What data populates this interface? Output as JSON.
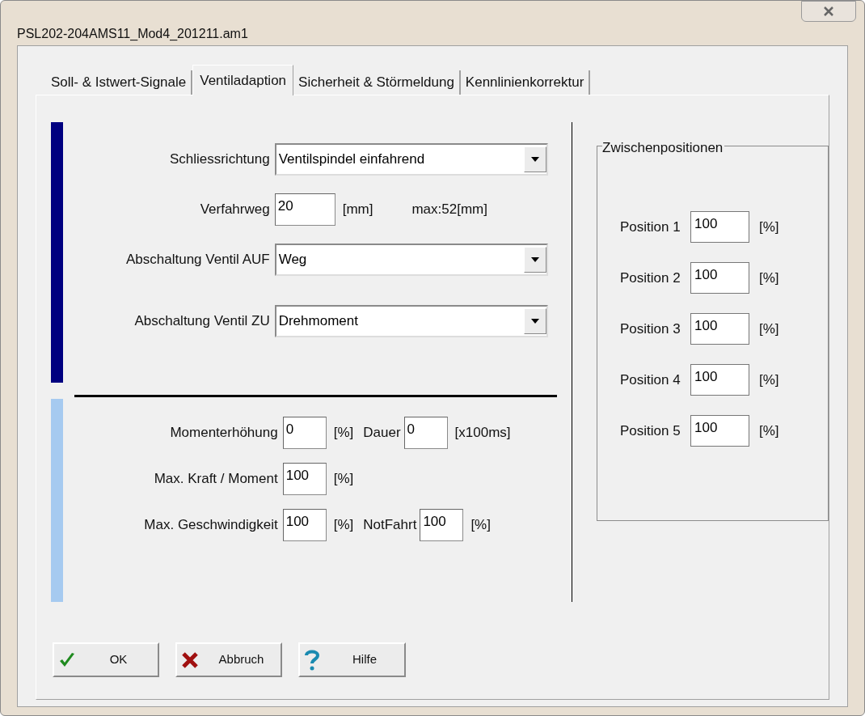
{
  "window": {
    "title": "PSL202-204AMS11_Mod4_201211.am1"
  },
  "tabs": [
    {
      "label": "Soll- & Istwert-Signale",
      "selected": false
    },
    {
      "label": "Ventiladaption",
      "selected": true
    },
    {
      "label": "Sicherheit & Störmeldung",
      "selected": false
    },
    {
      "label": "Kennlinienkorrektur",
      "selected": false
    }
  ],
  "valve_settings": [
    {
      "kind": "dropdown",
      "label": "Schliessrichtung",
      "value": "Ventilspindel einfahrend"
    },
    {
      "kind": "input",
      "label": "Verfahrweg",
      "value": "20",
      "unit": "[mm]",
      "note": "max:52[mm]"
    },
    {
      "kind": "dropdown",
      "label": "Abschaltung Ventil AUF",
      "value": "Weg"
    },
    {
      "kind": "dropdown",
      "label": "Abschaltung Ventil ZU",
      "value": "Drehmoment"
    }
  ],
  "drive_settings": [
    {
      "fields": [
        {
          "label": "Momenterhöhung",
          "value": "0",
          "unit": "[%]"
        },
        {
          "label": "Dauer",
          "value": "0",
          "unit": "[x100ms]"
        }
      ]
    },
    {
      "fields": [
        {
          "label": "Max. Kraft / Moment",
          "value": "100",
          "unit": "[%]"
        }
      ]
    },
    {
      "fields": [
        {
          "label": "Max. Geschwindigkeit",
          "value": "100",
          "unit": "[%]"
        },
        {
          "label": "NotFahrt",
          "value": "100",
          "unit": "[%]"
        }
      ]
    }
  ],
  "intermediate_positions": {
    "title": "Zwischenpositionen",
    "positions": [
      {
        "label": "Position 1",
        "value": "100",
        "unit": "[%]"
      },
      {
        "label": "Position 2",
        "value": "100",
        "unit": "[%]"
      },
      {
        "label": "Position 3",
        "value": "100",
        "unit": "[%]"
      },
      {
        "label": "Position 4",
        "value": "100",
        "unit": "[%]"
      },
      {
        "label": "Position 5",
        "value": "100",
        "unit": "[%]"
      }
    ]
  },
  "buttons": [
    {
      "kind": "ok",
      "label": "OK"
    },
    {
      "kind": "cancel",
      "label": "Abbruch"
    },
    {
      "kind": "help",
      "label": "Hilfe"
    }
  ]
}
